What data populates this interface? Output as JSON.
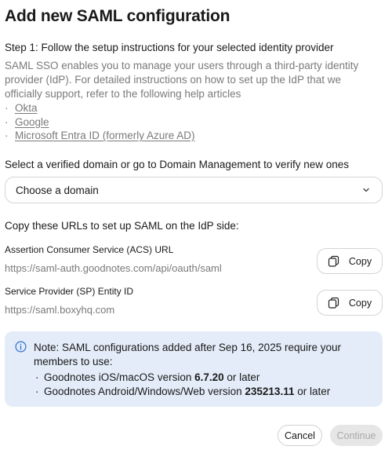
{
  "dialog": {
    "title": "Add new SAML configuration",
    "step_title": "Step 1: Follow the setup instructions for your selected identity provider",
    "description": "SAML SSO enables you to manage your users through a third-party identity provider (IdP). For detailed instructions on how to set up the IdP that we officially support, refer to the following help articles",
    "help_links": [
      {
        "bullet": "·",
        "label": "Okta"
      },
      {
        "bullet": "·",
        "label": "Google"
      },
      {
        "bullet": "·",
        "label": "Microsoft Entra ID (formerly Azure AD)"
      }
    ]
  },
  "domain": {
    "label": "Select a verified domain or go to Domain Management to verify new ones",
    "select_value": "Choose a domain",
    "chevron_icon": "chevron-down-icon"
  },
  "urls": {
    "heading": "Copy these URLs to set up SAML on the IdP side:",
    "acs": {
      "label": "Assertion Consumer Service (ACS) URL",
      "value": "https://saml-auth.goodnotes.com/api/oauth/saml",
      "copy_label": "Copy"
    },
    "entity": {
      "label": "Service Provider (SP) Entity ID",
      "value": "https://saml.boxyhq.com",
      "copy_label": "Copy"
    },
    "copy_icon": "copy-icon"
  },
  "note": {
    "icon": "info-icon",
    "intro": "Note: SAML configurations added after Sep 16, 2025 require your members to use:",
    "items": [
      {
        "bullet": "·",
        "prefix": "Goodnotes iOS/macOS version ",
        "version": "6.7.20",
        "suffix": " or later"
      },
      {
        "bullet": "·",
        "prefix": "Goodnotes Android/Windows/Web version ",
        "version": "235213.11",
        "suffix": " or later"
      }
    ],
    "background": "#e3ecf8",
    "accent": "#2f6fd1"
  },
  "footer": {
    "cancel_label": "Cancel",
    "continue_label": "Continue"
  }
}
